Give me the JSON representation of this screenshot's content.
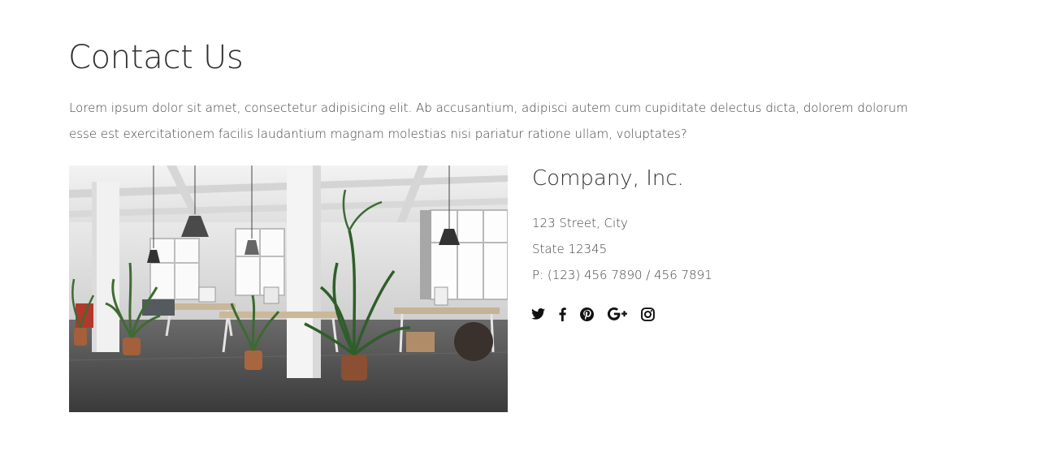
{
  "page": {
    "title": "Contact Us",
    "intro": "Lorem ipsum dolor sit amet, consectetur adipisicing elit. Ab accusantium, adipisci autem cum cupiditate delectus dicta, dolorem dolorum esse est exercitationem facilis laudantium magnam molestias nisi pariatur ratione ullam, voluptates?"
  },
  "image": {
    "subject": "office-interior-photo"
  },
  "company": {
    "name": "Company, Inc.",
    "address_line1": "123 Street, City",
    "address_line2": "State 12345",
    "phone": "P: (123) 456 7890 / 456 7891"
  },
  "social": {
    "icons": [
      "twitter-icon",
      "facebook-icon",
      "pinterest-icon",
      "google-plus-icon",
      "instagram-icon"
    ],
    "icon_color": "#111111"
  }
}
